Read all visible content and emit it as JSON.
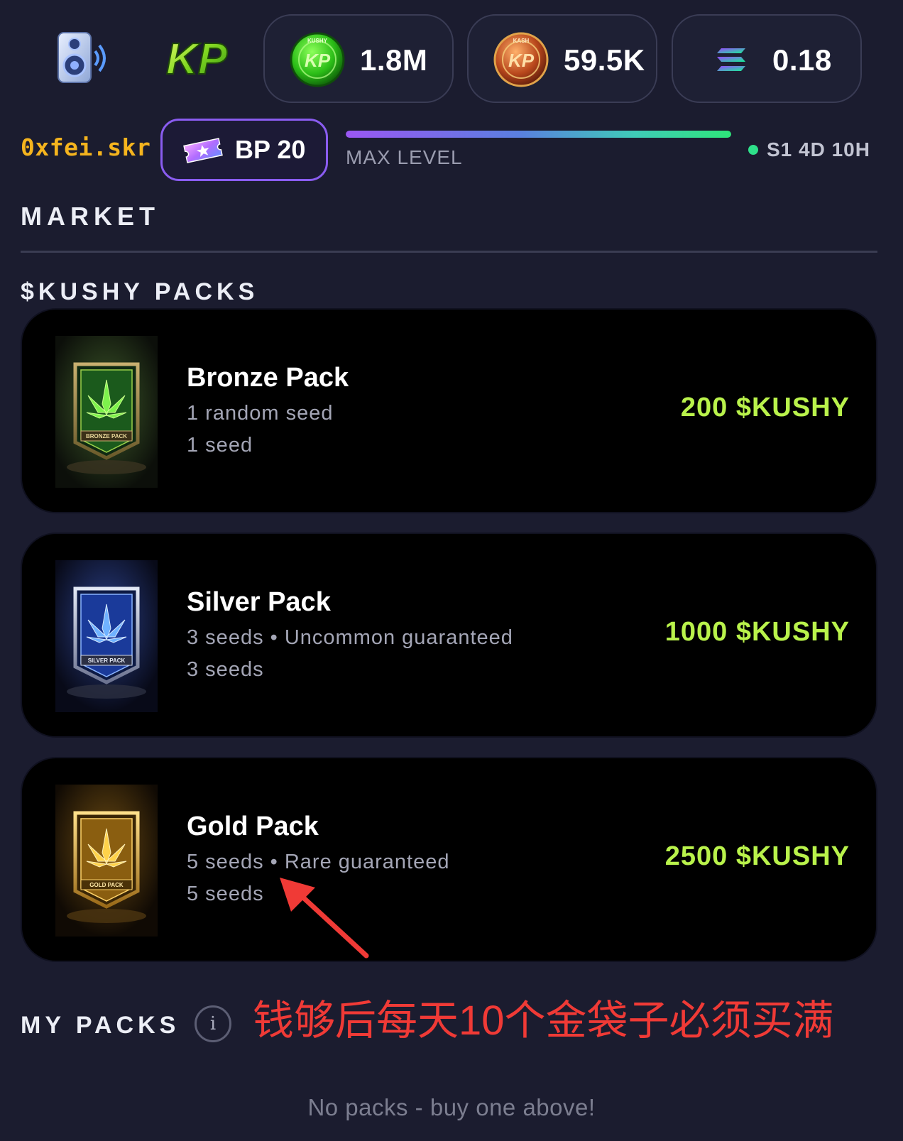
{
  "header": {
    "sound_icon": "speaker-icon",
    "logo_text": "KP",
    "balances": [
      {
        "currency_icon": "kushy-coin-icon",
        "coin_label": "KUSHY",
        "amount": "1.8M"
      },
      {
        "currency_icon": "kash-coin-icon",
        "coin_label": "KASH",
        "amount": "59.5K"
      },
      {
        "currency_icon": "solana-icon",
        "amount": "0.18"
      }
    ]
  },
  "user": {
    "name": "0xfei.skr",
    "battle_pass": "BP 20",
    "level_progress": 1.0,
    "level_label": "MAX LEVEL",
    "season": "S1 4D 10H"
  },
  "market": {
    "title": "MARKET",
    "section_title": "$KUSHY PACKS",
    "packs": [
      {
        "name": "Bronze Pack",
        "description": "1 random seed",
        "seeds": "1 seed",
        "price": "200 $KUSHY",
        "image_label": "BRONZE PACK"
      },
      {
        "name": "Silver Pack",
        "description": "3 seeds • Uncommon guaranteed",
        "seeds": "3 seeds",
        "price": "1000 $KUSHY",
        "image_label": "SILVER PACK"
      },
      {
        "name": "Gold Pack",
        "description": "5 seeds • Rare guaranteed",
        "seeds": "5 seeds",
        "price": "2500 $KUSHY",
        "image_label": "GOLD PACK"
      }
    ]
  },
  "my_packs": {
    "title": "MY PACKS",
    "info_label": "i",
    "empty_message": "No packs - buy one above!"
  },
  "annotation": {
    "text": "钱够后每天10个金袋子必须买满",
    "color": "#f03a36"
  },
  "colors": {
    "background": "#1b1c2f",
    "price": "#b9f24b",
    "username": "#f5b41e",
    "accent": "#8a5cf0"
  }
}
